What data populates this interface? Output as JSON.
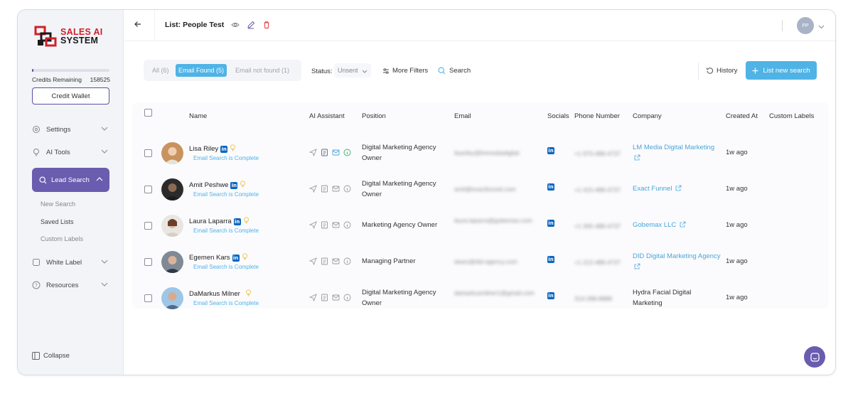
{
  "brand": {
    "line1": "SALES AI",
    "line2": "SYSTEM"
  },
  "credits": {
    "label": "Credits Remaining",
    "value": "158525",
    "fraction": 0.02
  },
  "sidebar": {
    "credit_wallet": "Credit Wallet",
    "settings": "Settings",
    "ai_tools": "AI Tools",
    "lead_search": "Lead Search",
    "sub_items": [
      "New Search",
      "Saved Lists",
      "Custom Labels"
    ],
    "white_label": "White Label",
    "resources": "Resources",
    "collapse": "Collapse"
  },
  "header": {
    "title": "List: People Test",
    "avatar": "PP"
  },
  "toolbar": {
    "filters": [
      "All (6)",
      "Email Found (5)",
      "Email not found (1)"
    ],
    "status_label": "Status:",
    "status_value": "Unsent",
    "more_filters": "More Filters",
    "search": "Search",
    "history": "History",
    "list_new_search": "List new search"
  },
  "table": {
    "columns": [
      "Name",
      "AI Assistant",
      "Position",
      "Email",
      "Socials",
      "Phone Number",
      "Company",
      "Created At",
      "Custom Labels"
    ],
    "rows": [
      {
        "name": "Lisa Riley",
        "status": "Email Search is Complete",
        "position": "Digital Marketing Agency Owner",
        "email": "lisariley@lmmediadigital",
        "phone": "+1 970-488-4737",
        "company": "LM Media Digital Marketing",
        "created": "1w ago"
      },
      {
        "name": "Amit Peshwe",
        "status": "Email Search is Complete",
        "position": "Digital Marketing Agency Owner",
        "email": "amit@exactfunnel.com",
        "phone": "+1 415-488-4737",
        "company": "Exact Funnel",
        "created": "1w ago"
      },
      {
        "name": "Laura Laparra",
        "status": "Email Search is Complete",
        "position": "Marketing Agency Owner",
        "email": "laura.laparra@gobemax.com",
        "phone": "+1 305-488-4737",
        "company": "Gobemax LLC",
        "created": "1w ago"
      },
      {
        "name": "Egemen Kars",
        "status": "Email Search is Complete",
        "position": "Managing Partner",
        "email": "ekars@did-agency.com",
        "phone": "+1 212-488-4737",
        "company": "DID Digital Marketing Agency",
        "created": "1w ago"
      },
      {
        "name": "DaMarkus Milner",
        "status": "Email Search is Complete",
        "position": "Digital Marketing Agency Owner",
        "email": "damarkusmilner1@gmail.com",
        "phone": "314-288-8888",
        "company": "Hydra Facial Digital Marketing",
        "created": "1w ago"
      }
    ]
  }
}
